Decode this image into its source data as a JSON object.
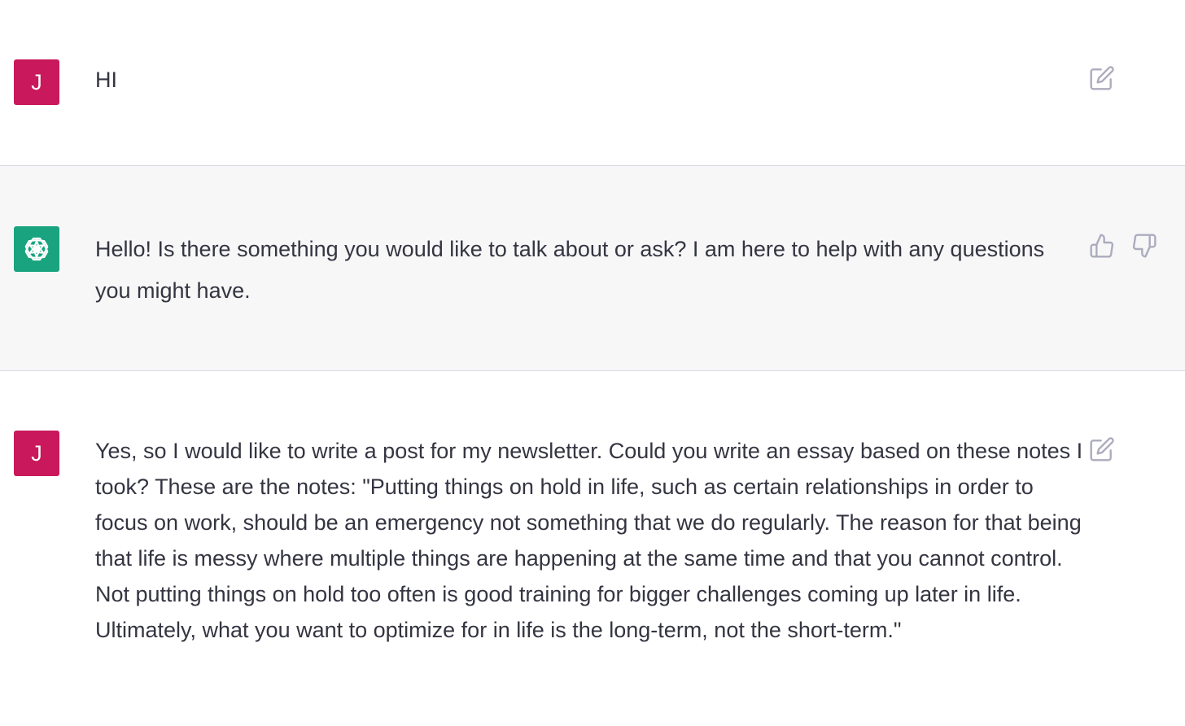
{
  "colors": {
    "user_avatar": "#c9185b",
    "assistant_avatar": "#19a37f",
    "assistant_background": "#f7f7f8",
    "text": "#343541",
    "icon": "#acacbe"
  },
  "messages": [
    {
      "role": "user",
      "avatar_initial": "J",
      "text": "HI",
      "actions": [
        "edit-icon"
      ]
    },
    {
      "role": "assistant",
      "avatar_icon": "openai-logo-icon",
      "text": "Hello! Is there something you would like to talk about or ask? I am here to help with any questions you might have.",
      "actions": [
        "thumbs-up-icon",
        "thumbs-down-icon"
      ]
    },
    {
      "role": "user",
      "avatar_initial": "J",
      "text": "Yes, so I would like to write a post for my newsletter. Could you write an essay based on these notes I took? These are the notes: \"Putting things on hold in life, such as certain relationships in order to focus on work, should be an emergency not something that we do regularly. The reason for that being that life is messy where multiple things are happening at the same time and that you cannot control. Not putting things on hold too often is good training for bigger challenges coming up later in life. Ultimately, what you want to optimize for in life is the long-term, not the short-term.\"",
      "actions": [
        "edit-icon"
      ]
    }
  ]
}
